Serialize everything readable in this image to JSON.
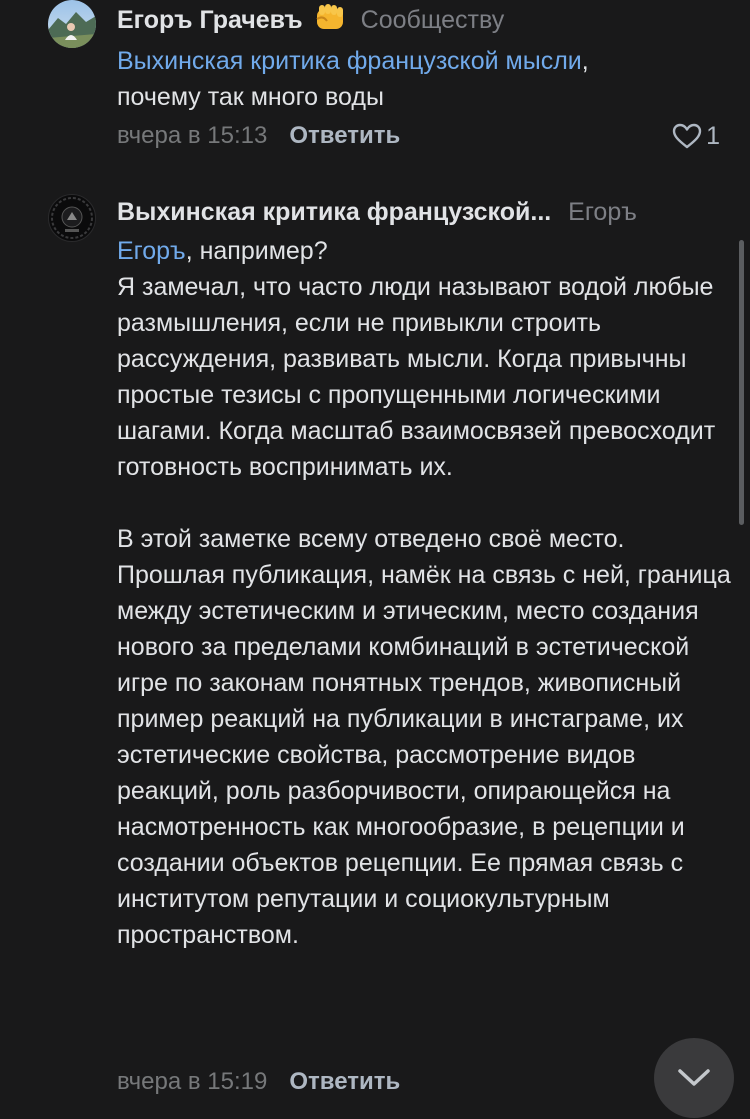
{
  "comments": [
    {
      "author": "Егоръ Грачевъ",
      "reply_to": "Сообществу",
      "emoji_icon": "fist-emoji",
      "link_text": "Выхинская критика французской мысли",
      "text_after_link": ",\nпочему так много воды",
      "time": "вчера в 15:13",
      "reply_label": "Ответить",
      "likes": "1"
    },
    {
      "author": "Выхинская критика французской...",
      "reply_to": "Егоръ",
      "link_text": "Егоръ",
      "text_after_link": ", например?\nЯ замечал, что часто люди называют водой любые размышления, если не привыкли строить рассуждения, развивать мысли. Когда привычны простые тезисы с пропущенными логическими шагами. Когда масштаб взаимосвязей превосходит готовность воспринимать их.\n\nВ этой заметке всему отведено своё место. Прошлая публикация, намёк на связь с ней, граница между эстетическим и этическим, место создания нового за пределами комбинаций в эстетической игре по законам понятных трендов, живописный пример реакций на публикации в инстаграме, их эстетические свойства, рассмотрение видов реакций, роль разборчивости, опирающейся на насмотренность как многообразие, в рецепции и создании объектов рецепции. Ее прямая связь с институтом репутации и социокультурным пространством.",
      "time": "вчера в 15:19",
      "reply_label": "Ответить"
    }
  ],
  "colors": {
    "background": "#19191a",
    "text": "#e1e3e6",
    "link": "#71aaeb",
    "muted": "#76787a",
    "action": "#aeb7c2"
  },
  "icons": {
    "like": "heart-outline-icon",
    "scroll_down": "chevron-down-icon"
  }
}
